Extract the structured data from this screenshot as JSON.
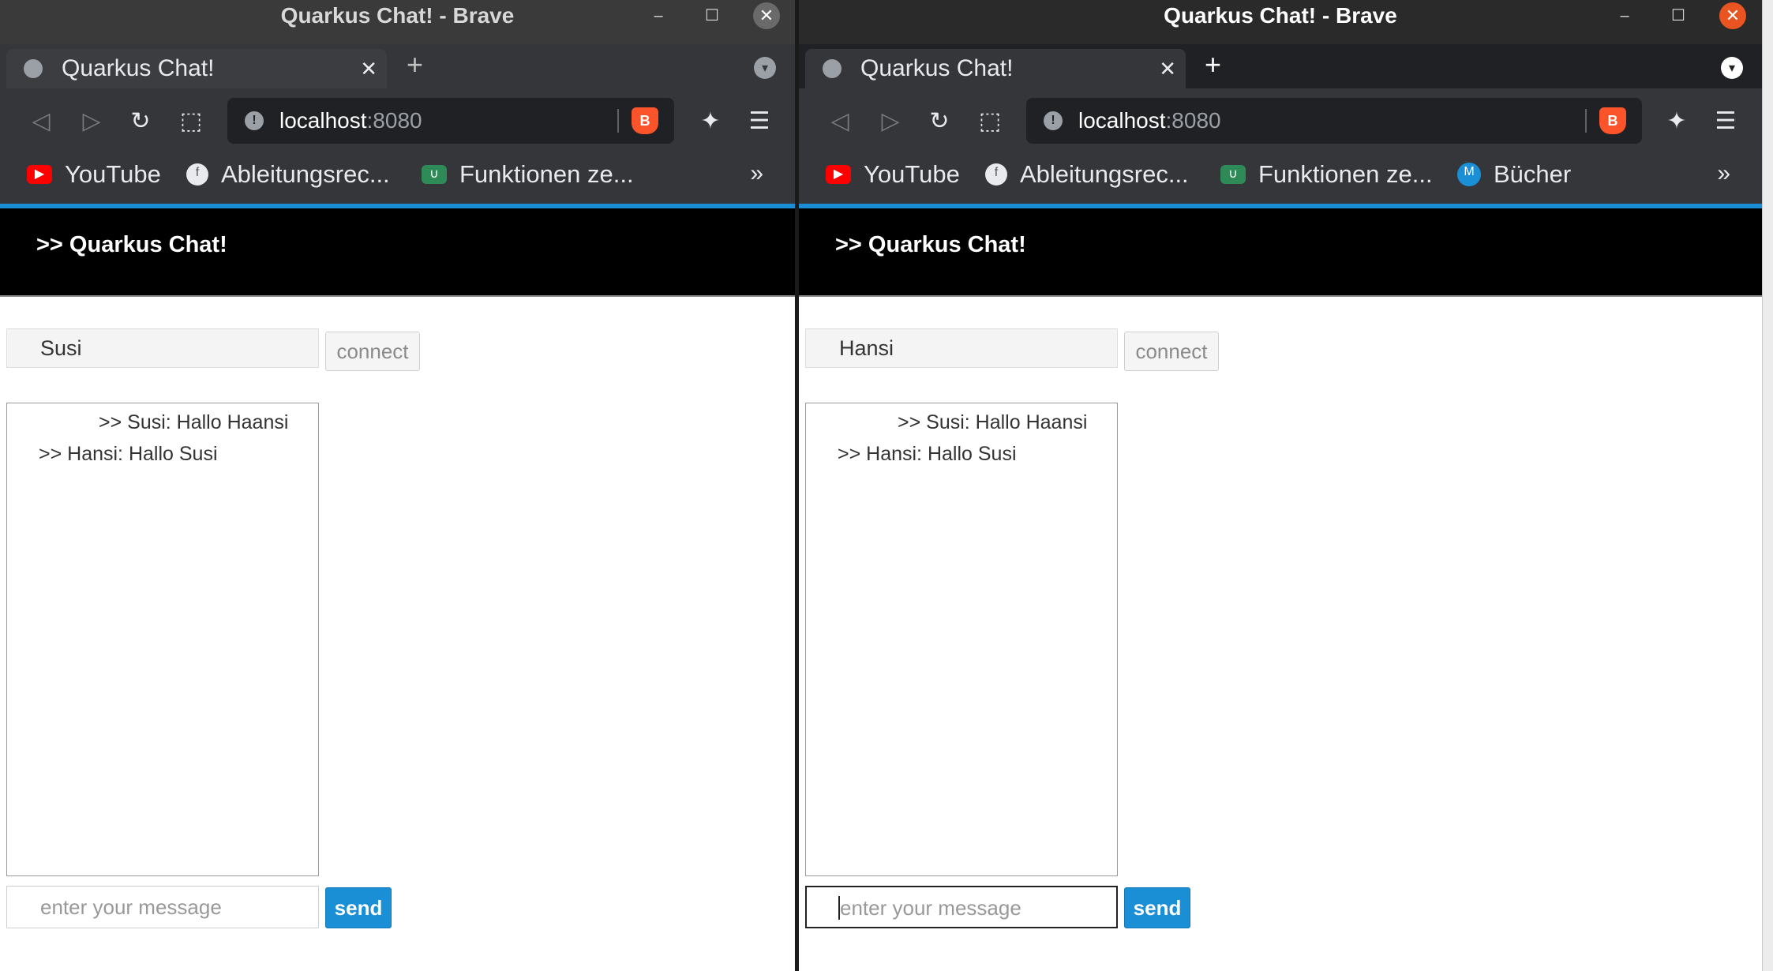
{
  "windows": [
    {
      "title": "Quarkus Chat! - Brave",
      "window_controls": {
        "minimize": "–",
        "maximize": "☐",
        "close": "✕"
      },
      "tab": {
        "title": "Quarkus Chat!",
        "close": "✕"
      },
      "new_tab": "+",
      "tab_menu": "▾",
      "toolbar": {
        "back": "◁",
        "forward": "▷",
        "reload": "↻",
        "bookmark": "⬚",
        "extensions": "✦",
        "menu": "☰"
      },
      "url": {
        "host": "localhost",
        "port": ":8080",
        "info": "!",
        "brave": "B"
      },
      "bookmarks": [
        {
          "label": "YouTube",
          "icon": "youtube-icon",
          "glyph": "▶"
        },
        {
          "label": "Ableitungsrec...",
          "icon": "fx-icon",
          "glyph": "f"
        },
        {
          "label": "Funktionen ze...",
          "icon": "function-plot-icon",
          "glyph": "∪"
        }
      ],
      "bookmarks_more": "»",
      "app": {
        "brand": ">> Quarkus Chat!",
        "name_value": "Susi",
        "connect_label": "connect",
        "messages": [
          ">> Susi: Hallo Haansi",
          ">> Hansi: Hallo Susi"
        ],
        "message_placeholder": "enter your message",
        "send_label": "send"
      }
    },
    {
      "title": "Quarkus Chat! - Brave",
      "window_controls": {
        "minimize": "–",
        "maximize": "☐",
        "close": "✕"
      },
      "tab": {
        "title": "Quarkus Chat!",
        "close": "✕"
      },
      "new_tab": "+",
      "tab_menu": "▾",
      "toolbar": {
        "back": "◁",
        "forward": "▷",
        "reload": "↻",
        "bookmark": "⬚",
        "extensions": "✦",
        "menu": "☰"
      },
      "url": {
        "host": "localhost",
        "port": ":8080",
        "info": "!",
        "brave": "B"
      },
      "bookmarks": [
        {
          "label": "YouTube",
          "icon": "youtube-icon",
          "glyph": "▶"
        },
        {
          "label": "Ableitungsrec...",
          "icon": "fx-icon",
          "glyph": "f"
        },
        {
          "label": "Funktionen ze...",
          "icon": "function-plot-icon",
          "glyph": "∪"
        },
        {
          "label": "Bücher",
          "icon": "books-icon",
          "glyph": "M"
        }
      ],
      "bookmarks_more": "»",
      "app": {
        "brand": ">> Quarkus Chat!",
        "name_value": "Hansi",
        "connect_label": "connect",
        "messages": [
          ">> Susi: Hallo Haansi",
          ">> Hansi: Hallo Susi"
        ],
        "message_placeholder": "enter your message",
        "send_label": "send"
      }
    }
  ],
  "colors": {
    "accent": "#1a8fd6",
    "brave_orange": "#fb542b",
    "close_active": "#e95420"
  }
}
